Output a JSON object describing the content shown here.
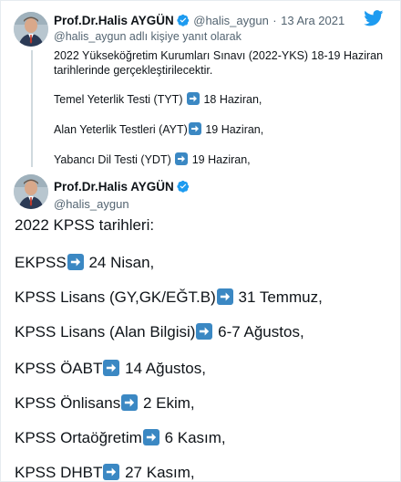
{
  "tweet1": {
    "author_name": "Prof.Dr.Halis AYGÜN",
    "handle": "@halis_aygun",
    "separator": "·",
    "date": "13 Ara 2021",
    "reply_to_handle": "@halis_aygun",
    "reply_to_suffix": "adlı kişiye yanıt olarak",
    "intro": "2022 Yükseköğretim Kurumları Sınavı (2022-YKS) 18-19 Haziran tarihlerinde gerçekleştirilecektir.",
    "lines": [
      {
        "label": "Temel Yeterlik Testi (TYT)",
        "date": "18 Haziran,"
      },
      {
        "label": "Alan Yeterlik Testleri (AYT)",
        "date": "19 Haziran,"
      },
      {
        "label": "Yabancı Dil Testi (YDT)",
        "date": "19 Haziran,"
      }
    ]
  },
  "tweet2": {
    "author_name": "Prof.Dr.Halis AYGÜN",
    "handle": "@halis_aygun",
    "heading": "2022 KPSS tarihleri:",
    "lines": [
      {
        "label": "EKPSS",
        "date": "24 Nisan,"
      },
      {
        "label": "KPSS Lisans (GY,GK/EĞT.B)",
        "date": "31 Temmuz,"
      },
      {
        "label": "KPSS Lisans (Alan Bilgisi)",
        "date": "6-7 Ağustos,"
      },
      {
        "label": "KPSS ÖABT",
        "date": "14 Ağustos,"
      },
      {
        "label": "KPSS Önlisans",
        "date": "2 Ekim,"
      },
      {
        "label": "KPSS Ortaöğretim",
        "date": "6 Kasım,"
      },
      {
        "label": "KPSS DHBT",
        "date": "27 Kasım,"
      }
    ]
  },
  "icons": {
    "verified": "verified-badge-icon",
    "twitter": "twitter-bird-icon",
    "arrow": "right-arrow-emoji-icon"
  },
  "colors": {
    "twitter_blue": "#1d9bf0",
    "emoji_blue": "#3b88c3",
    "text": "#0f1419",
    "muted": "#536471",
    "thread_line": "#cfd9de"
  }
}
